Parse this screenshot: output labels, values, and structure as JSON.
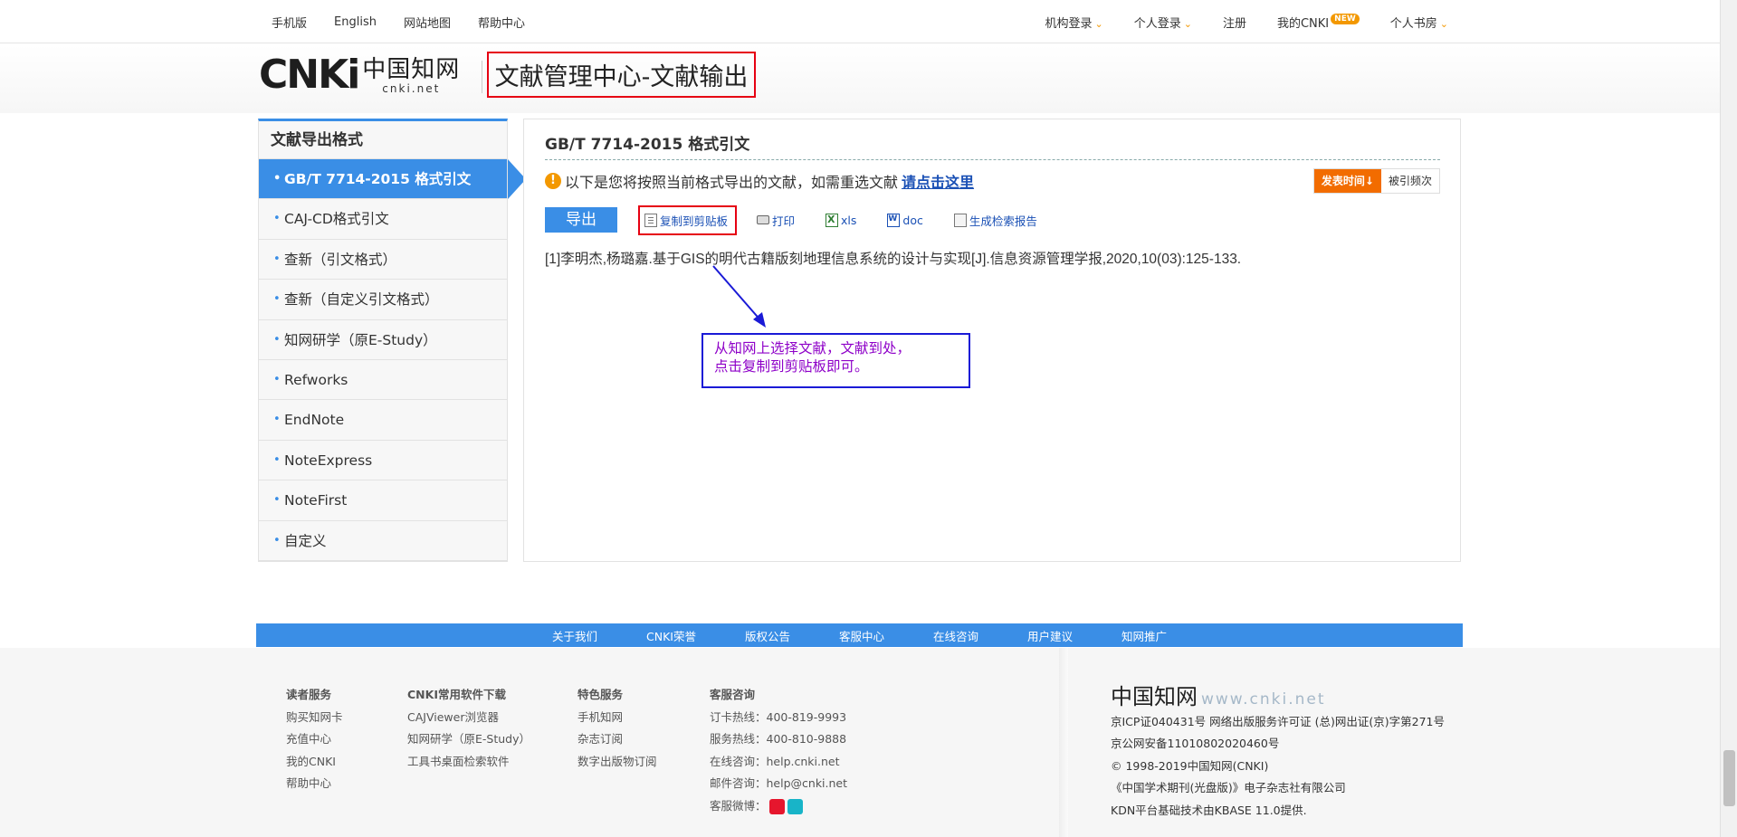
{
  "topbar": {
    "left_links": [
      "手机版",
      "English",
      "网站地图",
      "帮助中心"
    ],
    "right_links": [
      {
        "label": "机构登录",
        "dropdown": true
      },
      {
        "label": "个人登录",
        "dropdown": true
      },
      {
        "label": "注册",
        "dropdown": false
      },
      {
        "label": "我的CNKI",
        "dropdown": false,
        "badge": "NEW"
      },
      {
        "label": "个人书房",
        "dropdown": true
      }
    ]
  },
  "header": {
    "logo_text_latin": "CNKi",
    "logo_text_cn": "中国知网",
    "logo_url_text": "cnki.net",
    "page_title": "文献管理中心-文献输出"
  },
  "sidebar": {
    "heading": "文献导出格式",
    "items": [
      "GB/T 7714-2015 格式引文",
      "CAJ-CD格式引文",
      "查新（引文格式）",
      "查新（自定义引文格式）",
      "知网研学（原E-Study）",
      "Refworks",
      "EndNote",
      "NoteExpress",
      "NoteFirst",
      "自定义"
    ],
    "active_index": 0
  },
  "main": {
    "title": "GB/T 7714-2015 格式引文",
    "notice_text": "以下是您将按照当前格式导出的文献，如需重选文献",
    "notice_link": "请点击这里",
    "sort": {
      "primary": "发表时间",
      "secondary": "被引频次"
    },
    "toolbar": {
      "export": "导出",
      "copy": "复制到剪贴板",
      "print": "打印",
      "xls": "xls",
      "doc": "doc",
      "report": "生成检索报告"
    },
    "citation": "[1]李明杰,杨璐嘉.基于GIS的明代古籍版刻地理信息系统的设计与实现[J].信息资源管理学报,2020,10(03):125-133."
  },
  "annotation": {
    "line1": "从知网上选择文献，文献到处，",
    "line2": "点击复制到剪贴板即可。",
    "colors": {
      "border": "#1a1ad6",
      "text": "#8e00c8",
      "arrow": "#1a1ad6"
    }
  },
  "footer_nav": [
    "关于我们",
    "CNKI荣誉",
    "版权公告",
    "客服中心",
    "在线咨询",
    "用户建议",
    "知网推广"
  ],
  "footer": {
    "col1": {
      "heading": "读者服务",
      "items": [
        "购买知网卡",
        "充值中心",
        "我的CNKI",
        "帮助中心"
      ]
    },
    "col2": {
      "heading": "CNKI常用软件下载",
      "items": [
        "CAJViewer浏览器",
        "知网研学（原E-Study）",
        "工具书桌面检索软件"
      ]
    },
    "col3": {
      "heading": "特色服务",
      "items": [
        "手机知网",
        "杂志订阅",
        "数字出版物订阅"
      ]
    },
    "col4": {
      "heading": "客服咨询",
      "items": [
        "订卡热线：400-819-9993",
        "服务热线：400-810-9888",
        "在线咨询：help.cnki.net",
        "邮件咨询：help@cnki.net",
        "客服微博："
      ]
    },
    "right": {
      "logo_cn": "中国知网",
      "logo_url": "www.cnki.net",
      "lines": [
        "京ICP证040431号 网络出版服务许可证 (总)网出证(京)字第271号",
        "京公网安备11010802020460号",
        "© 1998-2019中国知网(CNKI)",
        "《中国学术期刊(光盘版)》电子杂志社有限公司",
        "KDN平台基础技术由KBASE 11.0提供."
      ]
    }
  },
  "colors": {
    "accent_blue": "#3a8ee6",
    "orange": "#f39800",
    "sort_orange": "#f26c00",
    "highlight_red": "#e60012",
    "link_blue": "#1a50b5"
  }
}
